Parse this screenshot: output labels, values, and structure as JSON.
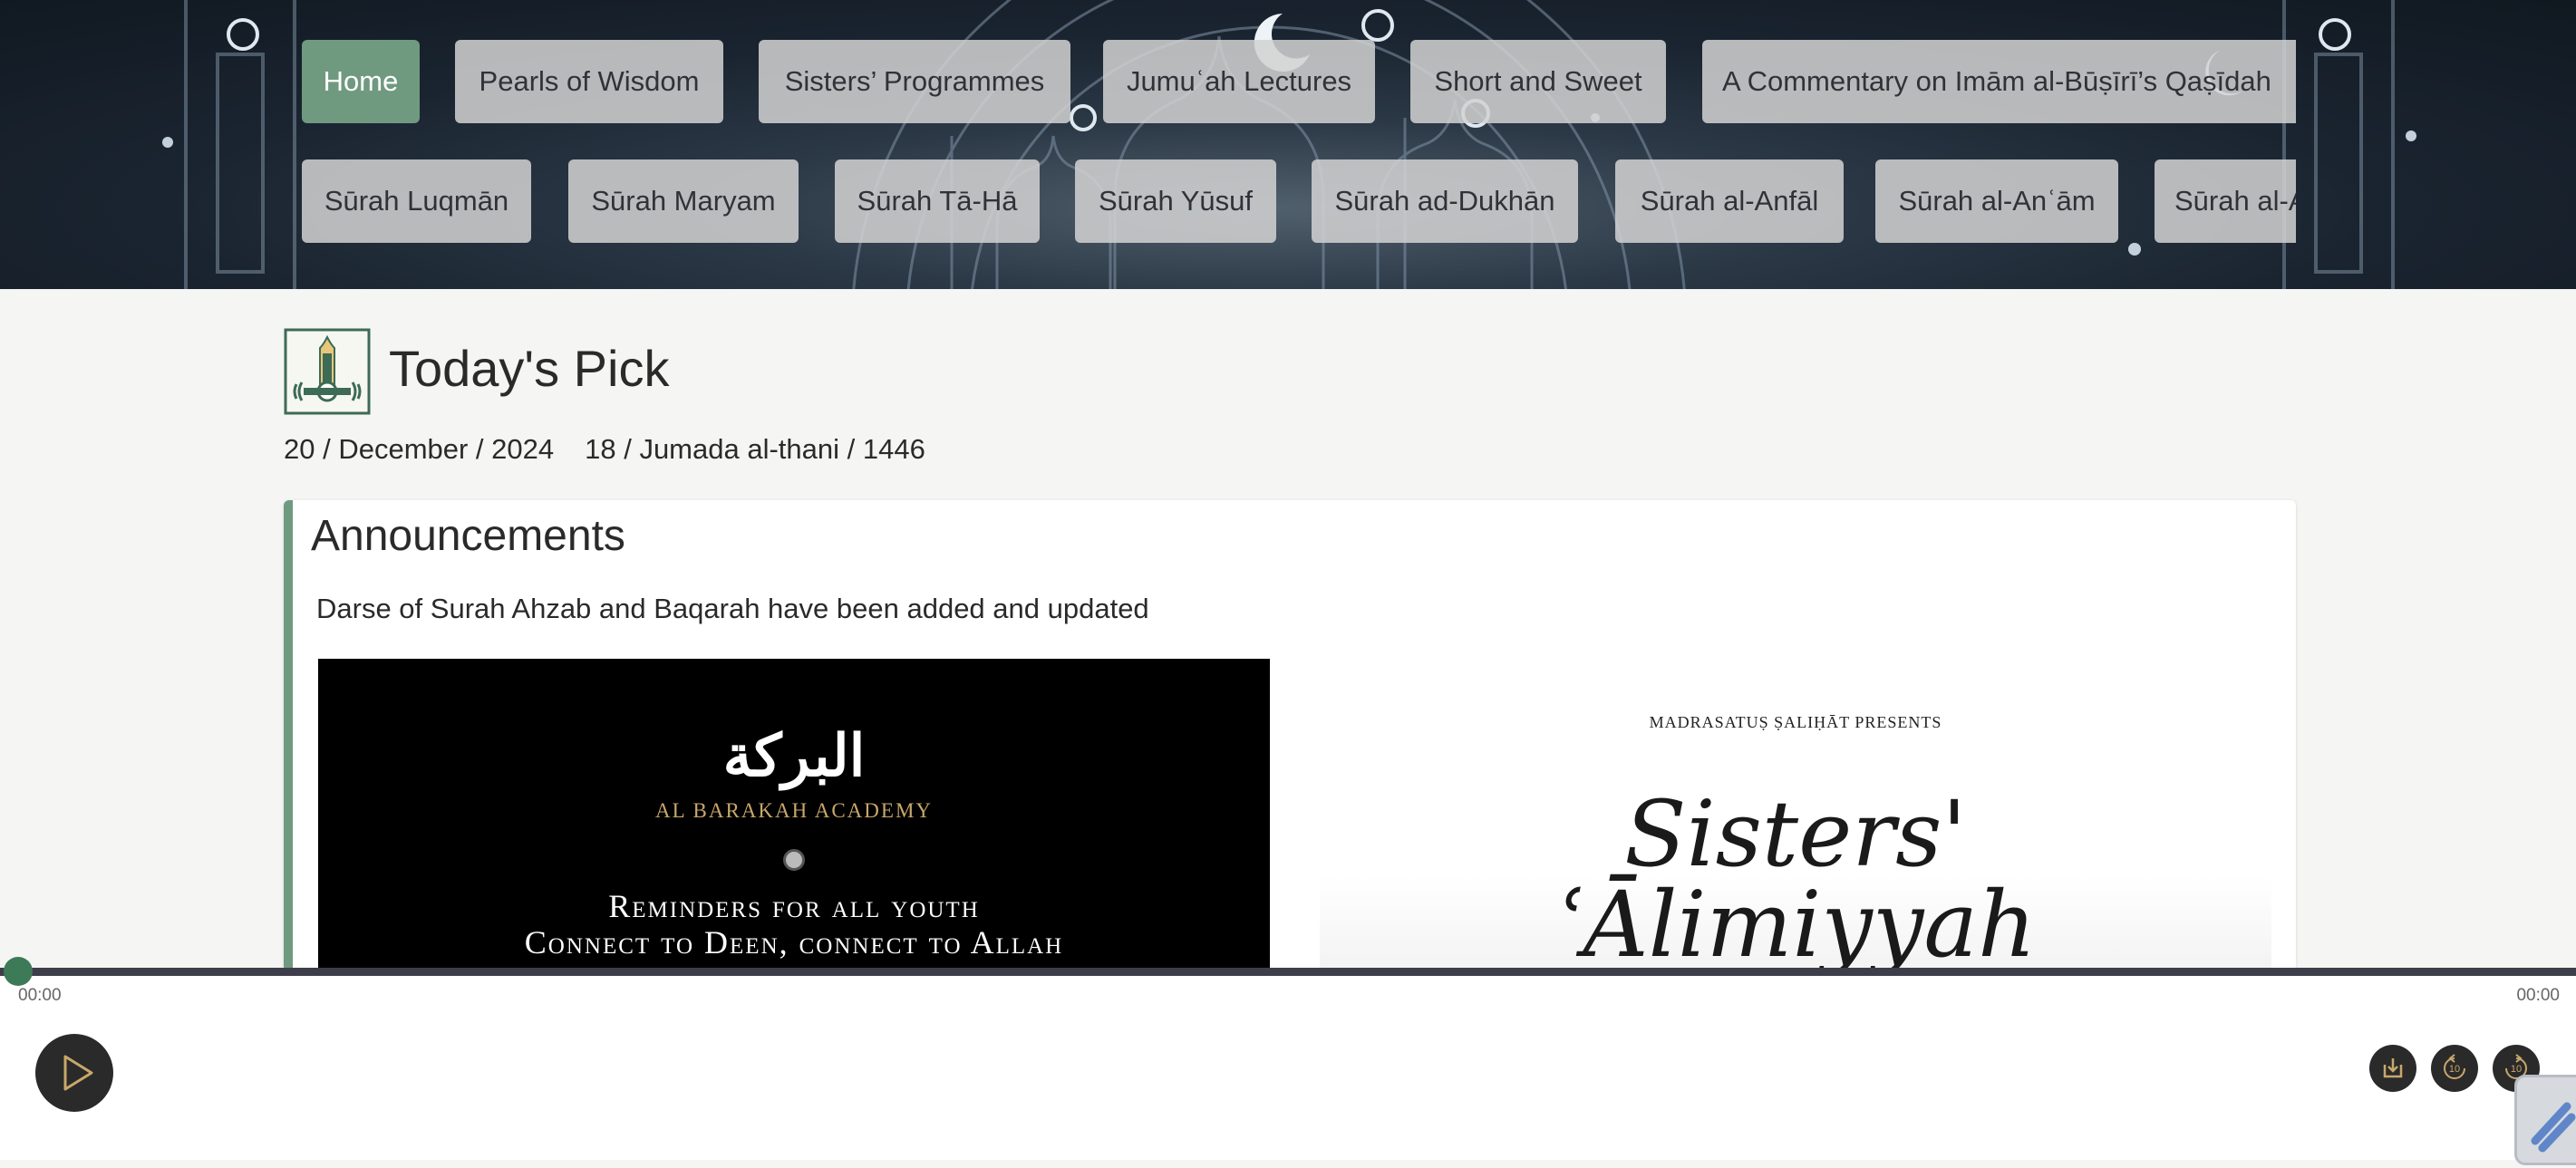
{
  "nav": {
    "row1": [
      {
        "label": "Home",
        "active": true
      },
      {
        "label": "Pearls of Wisdom"
      },
      {
        "label": "Sisters’ Programmes"
      },
      {
        "label": "Jumuʿah Lectures"
      },
      {
        "label": "Short and Sweet"
      },
      {
        "label": "A Commentary on Imām al-Būṣīrī’s Qaṣīdah"
      }
    ],
    "row2": [
      {
        "label": "Sūrah Luqmān"
      },
      {
        "label": "Sūrah Maryam"
      },
      {
        "label": "Sūrah Tā-Hā"
      },
      {
        "label": "Sūrah Yūsuf"
      },
      {
        "label": "Sūrah ad-Dukhān"
      },
      {
        "label": "Sūrah al-Anfāl"
      },
      {
        "label": "Sūrah al-Anʿām"
      },
      {
        "label": "Sūrah al-A"
      }
    ]
  },
  "today": {
    "title": "Today's Pick",
    "gregorian_date": "20 / December / 2024",
    "hijri_date": "18 / Jumada al-thani / 1446",
    "logo_icon": "mosque-minaret-logo-icon"
  },
  "announcements": {
    "heading": "Announcements",
    "text": "Darse of Surah Ahzab and Baqarah have been added and updated",
    "poster1": {
      "arabic": "البركة",
      "academy": "AL BARAKAH ACADEMY",
      "line1": "Reminders for all youth",
      "line2": "Connect to Deen, connect to Allah"
    },
    "poster2": {
      "presents": "MADRASATUṢ ṢALIḤĀT PRESENTS",
      "title1": "Sisters'",
      "title2": "ʿĀlimiyyah"
    }
  },
  "player": {
    "current_time": "00:00",
    "total_time": "00:00",
    "progress": 0,
    "play_icon": "play-icon",
    "download_icon": "download-icon",
    "rewind_icon": "rewind-10-icon",
    "forward_icon": "forward-10-icon",
    "rewind_label": "10",
    "forward_label": "10"
  },
  "colors": {
    "accent": "#6f9a80",
    "player_thumb": "#3d7a58",
    "player_controls": "#2a2a2a",
    "control_gold": "#c8a86a"
  }
}
